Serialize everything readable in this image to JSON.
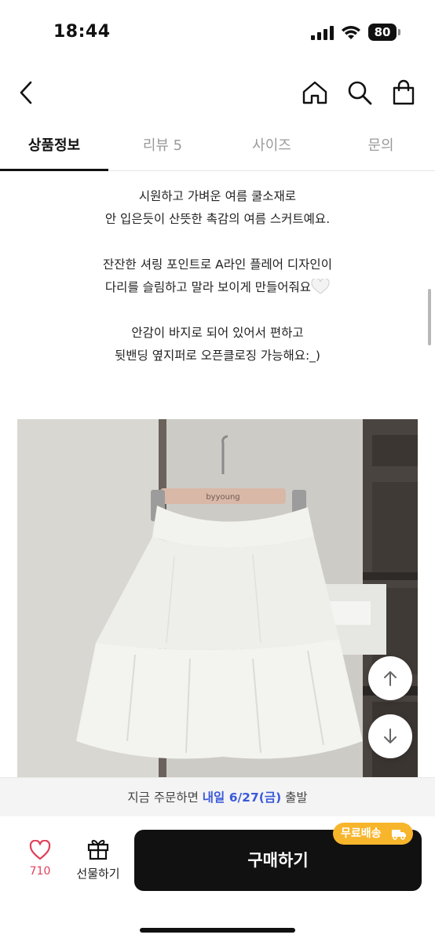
{
  "status": {
    "time": "18:44",
    "battery": "80"
  },
  "header": {
    "back_icon": "chevron-left-icon",
    "home_icon": "home-icon",
    "search_icon": "search-icon",
    "bag_icon": "shopping-bag-icon"
  },
  "tabs": [
    {
      "label": "상품정보",
      "active": true
    },
    {
      "label": "리뷰 5",
      "active": false
    },
    {
      "label": "사이즈",
      "active": false
    },
    {
      "label": "문의",
      "active": false
    }
  ],
  "description": {
    "line1": "시원하고 가벼운 여름 쿨소재로",
    "line2": "안 입은듯이 산뜻한 촉감의 여름 스커트예요.",
    "line3": "잔잔한 셔링 포인트로 A라인 플레어 디자인이",
    "line4": "다리를 슬림하고 말라 보이게 만들어줘요",
    "line5": "안감이 바지로 되어 있어서 편하고",
    "line6": "뒷밴딩 옆지퍼로 오픈클로징 가능해요:_)"
  },
  "photo": {
    "hanger_text": "byyoung"
  },
  "delivery": {
    "prefix": "지금 주문하면 ",
    "highlight": "내일 6/27(금)",
    "suffix": " 출발"
  },
  "bottom": {
    "like_count": "710",
    "gift_label": "선물하기",
    "buy_label": "구매하기",
    "free_shipping_badge": "무료배송"
  },
  "colors": {
    "accent_blue": "#3a5ad9",
    "like_red": "#e0405a",
    "badge_yellow": "#f7b52b",
    "buy_black": "#111111"
  }
}
